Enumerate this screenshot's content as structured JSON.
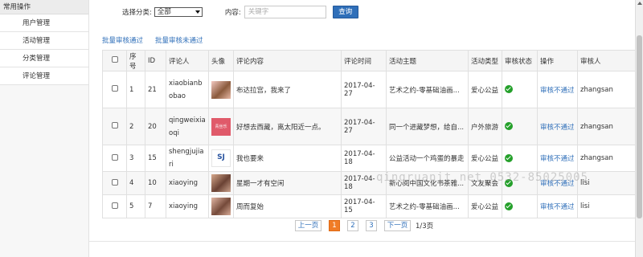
{
  "sidebar": {
    "header": "常用操作",
    "items": [
      {
        "label": "用户管理"
      },
      {
        "label": "活动管理"
      },
      {
        "label": "分类管理"
      },
      {
        "label": "评论管理"
      }
    ]
  },
  "filter": {
    "category_label": "选择分类:",
    "category_value": "全部",
    "keyword_label": "内容:",
    "keyword_placeholder": "关键字",
    "query_button": "查询"
  },
  "batch": {
    "approve": "批量审核通过",
    "reject": "批量审核未通过"
  },
  "table": {
    "headers": [
      "序号",
      "ID",
      "评论人",
      "头像",
      "评论内容",
      "评论时间",
      "活动主题",
      "活动类型",
      "审核状态",
      "操作",
      "审核人"
    ],
    "rows": [
      {
        "no": "1",
        "id": "21",
        "commenter": "xiaobianbobao",
        "content": "布达拉宫，我来了",
        "time": "2017-04-27",
        "theme": "艺术之约-零基础油画...",
        "type": "爱心公益",
        "action": "审核不通过",
        "reviewer": "zhangsan",
        "avatar_text": ""
      },
      {
        "no": "2",
        "id": "20",
        "commenter": "qingweixiaoqi",
        "content": "好想去西藏，离太阳近一点。",
        "time": "2017-04-27",
        "theme": "同一个进藏梦想，给自...",
        "type": "户外旅游",
        "action": "审核不通过",
        "reviewer": "zhangsan",
        "avatar_text": "青丝乐"
      },
      {
        "no": "3",
        "id": "15",
        "commenter": "shengjujiari",
        "content": "我也要来",
        "time": "2017-04-18",
        "theme": "公益活动一个鸡蛋的暴走",
        "type": "爱心公益",
        "action": "审核不通过",
        "reviewer": "zhangsan",
        "avatar_text": "SJ"
      },
      {
        "no": "4",
        "id": "10",
        "commenter": "xiaoying",
        "content": "星期一才有空闲",
        "time": "2017-04-18",
        "theme": "新心阅中国文化书茶雅...",
        "type": "文友聚会",
        "action": "审核不通过",
        "reviewer": "lisi",
        "avatar_text": ""
      },
      {
        "no": "5",
        "id": "7",
        "commenter": "xiaoying",
        "content": "周而复始",
        "time": "2017-04-15",
        "theme": "艺术之约-零基础油画...",
        "type": "爱心公益",
        "action": "审核不通过",
        "reviewer": "lisi",
        "avatar_text": ""
      }
    ]
  },
  "pagination": {
    "prev": "上一页",
    "pages": [
      "1",
      "2",
      "3"
    ],
    "current": "1",
    "next": "下一页",
    "total": "1/3页"
  },
  "watermark": "qingruanit.net 0532-85025005",
  "colors": {
    "primary": "#2f6fb9",
    "active_page": "#f07c26",
    "status_ok": "#25a02b"
  },
  "icons": {
    "status": "check-circle-icon",
    "select_caret": "caret-down-icon"
  }
}
